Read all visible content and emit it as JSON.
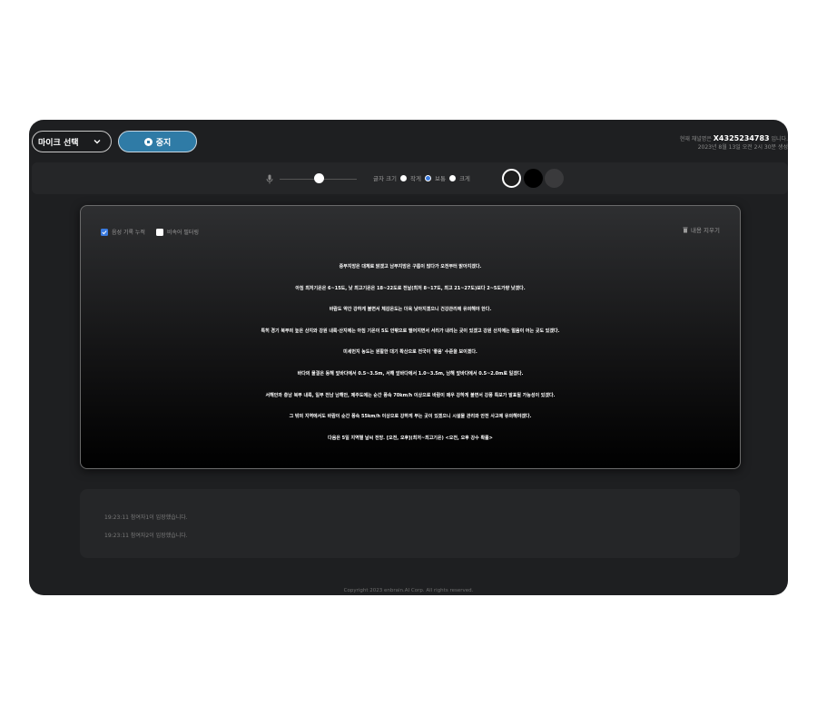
{
  "header": {
    "mic_select_label": "마이크 선택",
    "stop_label": "중지",
    "channel_prefix": "현재 채널명은",
    "channel_code": "X4325234783",
    "channel_suffix": "입니다.",
    "created_at": "2023년 8월 13일 오전 2시 30분 생성"
  },
  "controls": {
    "font_size_label": "글자 크기",
    "options": [
      "작게",
      "보통",
      "크게"
    ],
    "selected_option": "보통"
  },
  "transcript": {
    "accumulate_label": "음성 기록 누적",
    "accumulate_checked": true,
    "profanity_label": "비속어 필터링",
    "profanity_checked": false,
    "clear_label": "내용 지우기",
    "lines": [
      "중부지방은 대체로 맑겠고 남부지방은 구름이 많다가 오전부터 맑아지겠다.",
      "아침 최저기온은 6~15도, 낮 최고기온은 18~22도로 전날(최저 8~17도, 최고 21~27도)보다 2~5도가량 낮겠다.",
      "바람도 약간 강하게 불면서 체감온도는 더욱 낮아지겠으니 건강관리에 유의해야 한다.",
      "특히 경기 북부의 높은 산지와 강원 내륙·산지에는 아침 기온이 5도 안팎으로 떨어지면서 서리가 내리는 곳이 있겠고 강원 산지에는 얼음이 어는 곳도 있겠다.",
      "미세먼지 농도는 원활한 대기 확산으로 전국이 '좋음' 수준을 보이겠다.",
      "바다의 물결은 동해 앞바다에서 0.5~3.5m, 서해 앞바다에서 1.0~3.5m, 남해 앞바다에서 0.5~2.0m로 일겠다.",
      "서해안과 충남 북부 내륙, 일부 전남 남해안, 제주도에는 순간 풍속 70km/h 이상으로 바람이 매우 강하게 불면서 강풍 특보가 발표될 가능성이 있겠다.",
      "그 밖의 지역에서도 바람이 순간 풍속 55km/h 이상으로 강하게 부는 곳이 있겠으니 시설물 관리와 안전 사고에 유의해야겠다.",
      "다음은 5일 지역별 날씨 전망. [오전, 오후](최저~최고기온) <오전, 오후 강수 확률>"
    ]
  },
  "log": [
    "19:23:11 참여자1이 입장했습니다.",
    "19:23:11 참여자2이 입장했습니다."
  ],
  "footer": {
    "copyright": "Copyright 2023 enbrain.AI Corp. All rights reserved."
  },
  "colors": {
    "accent_blue": "#2f7ba6",
    "panel_bg": "#1e1f21"
  }
}
